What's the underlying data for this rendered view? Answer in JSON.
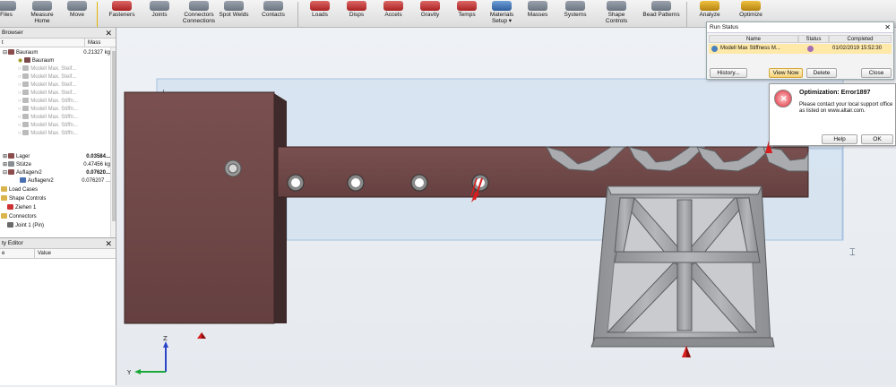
{
  "ribbon": {
    "items": [
      {
        "label": "Files",
        "label2": ""
      },
      {
        "label": "Measure",
        "label2": "Home"
      },
      {
        "label": "Move",
        "label2": ""
      },
      {
        "label": "Fasteners",
        "label2": ""
      },
      {
        "label": "Joints",
        "label2": ""
      },
      {
        "label": "Connectors",
        "label2": "Connections"
      },
      {
        "label": "Spot Welds",
        "label2": ""
      },
      {
        "label": "Contacts",
        "label2": ""
      },
      {
        "label": "Loads",
        "label2": ""
      },
      {
        "label": "Disps",
        "label2": ""
      },
      {
        "label": "Accels",
        "label2": ""
      },
      {
        "label": "Gravity",
        "label2": ""
      },
      {
        "label": "Temps",
        "label2": ""
      },
      {
        "label": "Materials",
        "label2": "Setup"
      },
      {
        "label": "Masses",
        "label2": ""
      },
      {
        "label": "Systems",
        "label2": ""
      },
      {
        "label": "Shape Controls",
        "label2": ""
      },
      {
        "label": "Bead Patterns",
        "label2": ""
      },
      {
        "label": "Analyze",
        "label2": ""
      },
      {
        "label": "Optimize",
        "label2": ""
      }
    ]
  },
  "browser": {
    "title": "Browser",
    "col_name": "t",
    "col_mass": "Mass",
    "rows": [
      {
        "label": "Bauraum",
        "mass": "0.21327 kg",
        "bold": false
      },
      {
        "label": "Bauraum",
        "mass": "",
        "bold": false
      },
      {
        "label": "Modell Max. Steif...",
        "mass": "",
        "bold": false
      },
      {
        "label": "Modell Max. Steif...",
        "mass": "",
        "bold": false
      },
      {
        "label": "Modell Max. Steif...",
        "mass": "",
        "bold": false
      },
      {
        "label": "Modell Max. Steif...",
        "mass": "",
        "bold": false
      },
      {
        "label": "Modell Max. Stiffn...",
        "mass": "",
        "bold": false
      },
      {
        "label": "Modell Max. Stiffn...",
        "mass": "",
        "bold": false
      },
      {
        "label": "Modell Max. Stiffn...",
        "mass": "",
        "bold": false
      },
      {
        "label": "Modell Max. Stiffn...",
        "mass": "",
        "bold": false
      },
      {
        "label": "Modell Max. Stiffn...",
        "mass": "",
        "bold": false
      },
      {
        "label": "Lager",
        "mass": "0.03584...",
        "bold": true
      },
      {
        "label": "Stütze",
        "mass": "0.47456 kg",
        "bold": false
      },
      {
        "label": "Auflagerv2",
        "mass": "0.07620...",
        "bold": true
      },
      {
        "label": "Auflagerv2",
        "mass": "0.076207 ...",
        "bold": false
      },
      {
        "label": "Load Cases",
        "mass": "",
        "bold": false
      },
      {
        "label": "Shape Controls",
        "mass": "",
        "bold": false
      },
      {
        "label": "Ziehen 1",
        "mass": "",
        "bold": false
      },
      {
        "label": "Connectors",
        "mass": "",
        "bold": false
      },
      {
        "label": "Joint 1 (Pin)",
        "mass": "",
        "bold": false
      }
    ]
  },
  "property_editor": {
    "title": "ty Editor",
    "col_property": "e",
    "col_value": "Value"
  },
  "run_status": {
    "title": "Run Status",
    "col_name": "Name",
    "col_status": "Status",
    "col_completed": "Completed",
    "row_name": "Modell Max Stiffness M...",
    "row_completed": "01/02/2019 15:52:30",
    "history_label": "History...",
    "view_now_label": "View Now",
    "delete_label": "Delete",
    "close_label": "Close"
  },
  "optimization_popup": {
    "title": "Optimization: Error1897",
    "message_line1": "Please contact your local support office",
    "message_line2": "as listed on www.altair.com.",
    "help_label": "Help",
    "ok_label": "OK"
  },
  "axes": {
    "z": "Z",
    "y": "Y"
  },
  "colors": {
    "part_brown": "#6f4848",
    "support_grey": "#9ea0a3",
    "design_space_blue": "#c9dbee",
    "load_red": "#d81e1e"
  }
}
